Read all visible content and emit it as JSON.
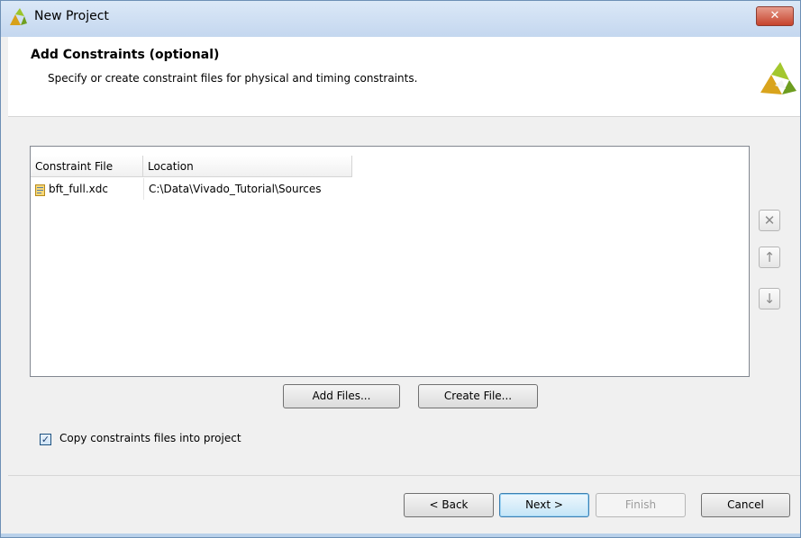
{
  "window": {
    "title": "New Project",
    "close_glyph": "✕"
  },
  "header": {
    "title": "Add Constraints (optional)",
    "description": "Specify or create constraint files for physical and timing constraints.",
    "logo_icon": "vivado-logo-icon"
  },
  "table": {
    "columns": [
      "Constraint File",
      "Location"
    ],
    "rows": [
      {
        "file": "bft_full.xdc",
        "location": "C:\\Data\\Vivado_Tutorial\\Sources",
        "icon": "constraint-file-icon"
      }
    ]
  },
  "side_buttons": {
    "remove": "✕",
    "move_up": "↑",
    "move_down": "↓"
  },
  "actions": {
    "add_files": "Add Files...",
    "create_file": "Create File..."
  },
  "copy_option": {
    "checked": true,
    "check_glyph": "✓",
    "label": "Copy constraints files into project"
  },
  "footer": {
    "back": "< Back",
    "next": "Next >",
    "finish": "Finish",
    "cancel": "Cancel"
  }
}
